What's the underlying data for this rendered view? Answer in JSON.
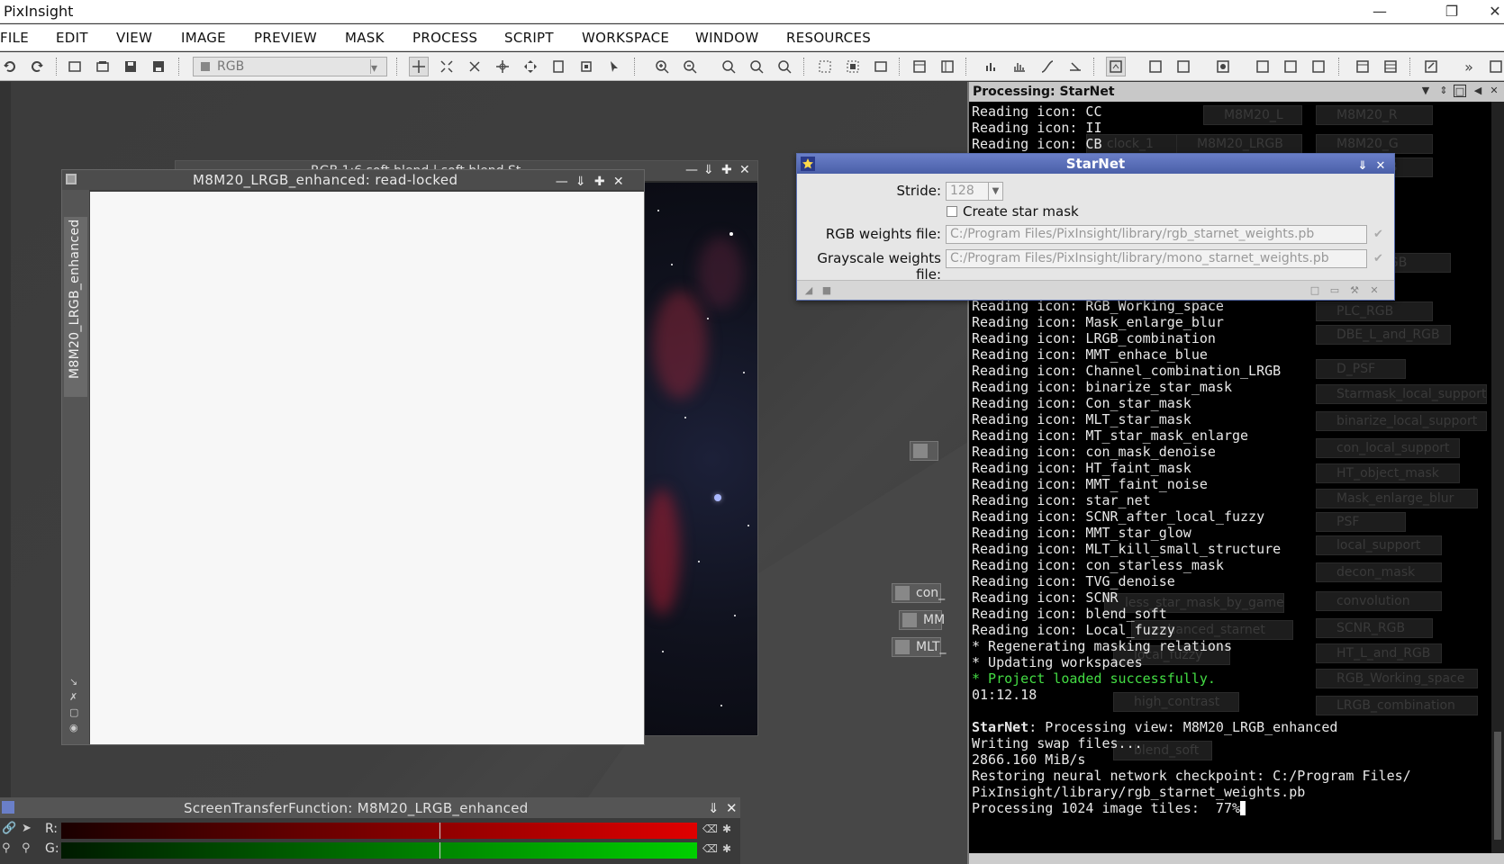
{
  "app": {
    "title": "PixInsight"
  },
  "menu": [
    "FILE",
    "EDIT",
    "VIEW",
    "IMAGE",
    "PREVIEW",
    "MASK",
    "PROCESS",
    "SCRIPT",
    "WORKSPACE",
    "WINDOW",
    "RESOURCES"
  ],
  "toolbar": {
    "view_combo_value": "RGB"
  },
  "bg_window": {
    "title": "RGB 1:6 soft blend | soft blend St"
  },
  "image_window": {
    "title": "M8M20_LRGB_enhanced: read-locked",
    "side_tab": "M8M20_LRGB_enhanced"
  },
  "workspace_icons": [
    {
      "label": "con_"
    },
    {
      "label": "MM"
    },
    {
      "label": "MLT_"
    }
  ],
  "stf": {
    "title": "ScreenTransferFunction: M8M20_LRGB_enhanced",
    "r_label": "R:",
    "g_label": "G:"
  },
  "console": {
    "title": "Processing: StarNet",
    "lines_top": [
      "Reading icon: CC",
      "Reading icon: II",
      "Reading icon: CB"
    ],
    "lines_main": [
      "Reading icon: RGB_Working_space",
      "Reading icon: Mask_enlarge_blur",
      "Reading icon: LRGB_combination",
      "Reading icon: MMT_enhace_blue",
      "Reading icon: Channel_combination_LRGB",
      "Reading icon: binarize_star_mask",
      "Reading icon: Con_star_mask",
      "Reading icon: MLT_star_mask",
      "Reading icon: MT_star_mask_enlarge",
      "Reading icon: con_mask_denoise",
      "Reading icon: HT_faint_mask",
      "Reading icon: MMT_faint_noise",
      "Reading icon: star_net",
      "Reading icon: SCNR_after_local_fuzzy",
      "Reading icon: MMT_star_glow",
      "Reading icon: MLT_kill_small_structure",
      "Reading icon: con_starless_mask",
      "Reading icon: TVG_denoise",
      "Reading icon: SCNR",
      "Reading icon: blend_soft",
      "Reading icon: Local_fuzzy",
      "* Regenerating masking relations",
      "* Updating workspaces"
    ],
    "success": "* Project loaded successfully.",
    "elapsed": "01:12.18",
    "process_name": "StarNet",
    "process_line": ": Processing view: M8M20_LRGB_enhanced",
    "lines_tail": [
      "Writing swap files...",
      "2866.160 MiB/s",
      "Restoring neural network checkpoint: C:/Program Files/",
      "PixInsight/library/rgb_starnet_weights.pb"
    ],
    "progress_line": "Processing 1024 image tiles:  77%",
    "ghost_icons": [
      "M8M20_L",
      "M8M20_R",
      "clock_1",
      "M8M20_LRGB",
      "M8M20_G",
      "M8M20_B",
      "L_and_RGB",
      "PLC_RGB",
      "DBE_L_and_RGB",
      "D_PSF",
      "Starmask_local_support",
      "binarize_local_support",
      "con_local_support",
      "HT_object_mask",
      "Mask_enlarge_blur",
      "PSF",
      "local_support",
      "decon_mask",
      "convolution",
      "SCNR_RGB",
      "HT_L_and_RGB",
      "RGB_Working_space",
      "LRGB_combination",
      "less_star_mask_by_game",
      "enhanced_starnet",
      "local_fuzzy",
      "high_contrast",
      "blend_soft"
    ]
  },
  "starnet": {
    "title": "StarNet",
    "stride_label": "Stride:",
    "stride_value": "128",
    "create_mask_label": "Create star mask",
    "create_mask_checked": false,
    "rgb_label": "RGB weights file:",
    "rgb_value": "C:/Program Files/PixInsight/library/rgb_starnet_weights.pb",
    "gray_label": "Grayscale weights file:",
    "gray_value": "C:/Program Files/PixInsight/library/mono_starnet_weights.pb"
  },
  "colors": {
    "dialog_title": "#5567b5",
    "console_bg": "#000000",
    "success_green": "#44dd44"
  }
}
